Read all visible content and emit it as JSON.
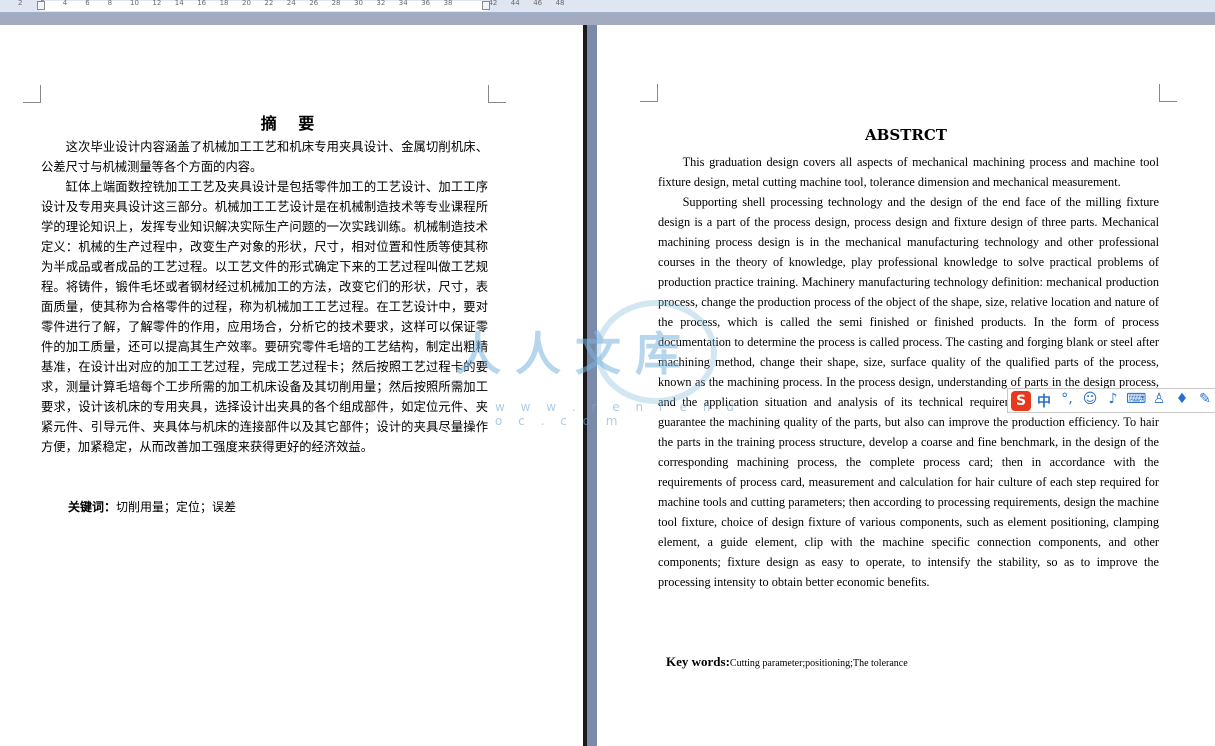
{
  "ruler": {
    "labels": [
      "2",
      "2",
      "4",
      "6",
      "8",
      "10",
      "12",
      "14",
      "16",
      "18",
      "20",
      "22",
      "24",
      "26",
      "28",
      "30",
      "32",
      "34",
      "36",
      "38",
      "42",
      "44",
      "46",
      "48"
    ]
  },
  "left_page": {
    "title": "摘  要",
    "paragraphs": [
      "这次毕业设计内容涵盖了机械加工工艺和机床专用夹具设计、金属切削机床、公差尺寸与机械测量等各个方面的内容。",
      "缸体上端面数控铣加工工艺及夹具设计是包括零件加工的工艺设计、加工工序设计及专用夹具设计这三部分。机械加工工艺设计是在机械制造技术等专业课程所学的理论知识上，发挥专业知识解决实际生产问题的一次实践训练。机械制造技术定义：机械的生产过程中，改变生产对象的形状，尺寸，相对位置和性质等使其称为半成品或者成品的工艺过程。以工艺文件的形式确定下来的工艺过程叫做工艺规程。将铸件，锻件毛坯或者钢材经过机械加工的方法，改变它们的形状，尺寸，表面质量，使其称为合格零件的过程，称为机械加工工艺过程。在工艺设计中，要对零件进行了解，了解零件的作用，应用场合，分析它的技术要求，这样可以保证零件的加工质量，还可以提高其生产效率。要研究零件毛培的工艺结构，制定出粗精基准，在设计出对应的加工工艺过程，完成工艺过程卡；然后按照工艺过程卡的要求，测量计算毛培每个工步所需的加工机床设备及其切削用量；然后按照所需加工要求，设计该机床的专用夹具，选择设计出夹具的各个组成部件，如定位元件、夹紧元件、引导元件、夹具体与机床的连接部件以及其它部件；设计的夹具尽量操作方便，加紧稳定，从而改善加工强度来获得更好的经济效益。"
    ],
    "keywords_label": "关键词：",
    "keywords_value": "切削用量；定位；误差"
  },
  "right_page": {
    "title": "ABSTRCT",
    "paragraphs": [
      "This graduation design covers all aspects of mechanical machining process and machine tool fixture design, metal cutting machine tool, tolerance dimension and mechanical measurement.",
      "Supporting shell processing technology and the design of the end face of the milling fixture design is a part of the process design, process design and fixture design of three parts. Mechanical machining process design is in the mechanical manufacturing technology and other professional courses in the theory of knowledge, play professional knowledge to solve practical problems of production practice training. Machinery manufacturing technology definition: mechanical production process, change the production process of the object of the shape, size, relative location and nature of the process, which is called the semi finished or finished products. In the form of process documentation to determine the process is called process. The casting and forging blank or steel after machining method, change their shape, size, surface quality of the qualified parts of the process, known as the machining process. In the process design, understanding of parts in the design process, and the application situation and analysis of its technical requirements. Only in this way can guarantee the machining quality of the parts, but also can improve the production efficiency. To hair the parts in the training process structure, develop a coarse and fine benchmark, in the design of the corresponding machining process, the complete process card; then in accordance with the requirements of process card, measurement and calculation for hair culture of each step required for machine tools and cutting parameters; then according to processing requirements, design the machine tool fixture, choice of design fixture of various components, such as element positioning, clamping element, a guide element, clip with the machine specific connection components, and other components; fixture design as easy to operate, to intensify the stability, so as to improve the processing intensity to obtain better economic benefits."
    ],
    "keywords_label": "Key words:",
    "keywords_value": "Cutting parameter;positioning;The tolerance"
  },
  "watermark": {
    "text": "人人文库",
    "url": "w w w . r e n r e n d o c . c o m"
  },
  "ime_toolbar": {
    "logo": "S",
    "items": [
      {
        "name": "lang-toggle",
        "glyph": "中",
        "bold": true
      },
      {
        "name": "punct-icon",
        "glyph": "°,",
        "bold": false
      },
      {
        "name": "emoji-icon",
        "glyph": "☺",
        "bold": false
      },
      {
        "name": "mic-icon",
        "glyph": "♪",
        "bold": false
      },
      {
        "name": "keyboard-icon",
        "glyph": "⌨",
        "bold": false
      },
      {
        "name": "user-icon",
        "glyph": "♙",
        "bold": false
      },
      {
        "name": "skin-icon",
        "glyph": "♦",
        "bold": false
      },
      {
        "name": "tools-icon",
        "glyph": "✎",
        "bold": false
      }
    ]
  },
  "colors": {
    "workspace": "#7a8aa8",
    "page": "#ffffff",
    "ime_logo": "#e8391e",
    "ime_icon": "#2a6fc9"
  }
}
